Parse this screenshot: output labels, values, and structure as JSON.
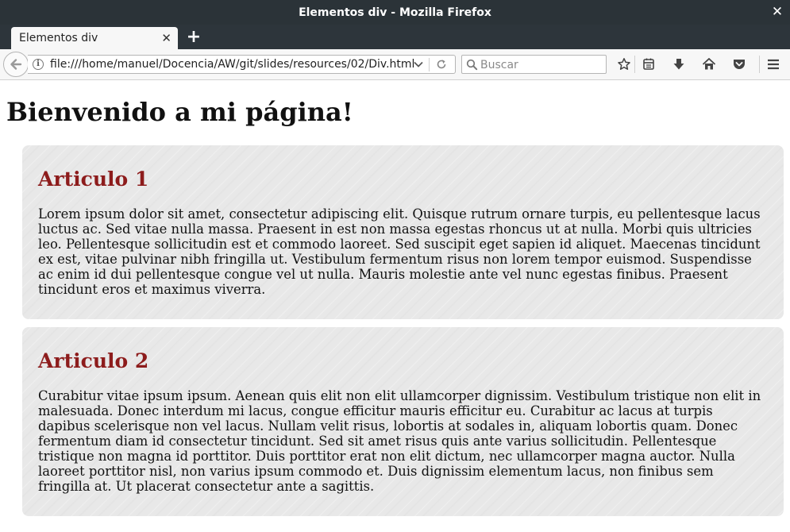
{
  "window": {
    "title": "Elementos div - Mozilla Firefox",
    "close_glyph": "✕"
  },
  "tabs": [
    {
      "label": "Elementos div",
      "close_glyph": "✕"
    }
  ],
  "new_tab_glyph": "+",
  "navbar": {
    "info_glyph": "i",
    "url": "file:///home/manuel/Docencia/AW/git/slides/resources/02/Div.html",
    "search_placeholder": "Buscar",
    "icons": [
      "back-arrow-icon",
      "info-icon",
      "dropdown-arrow-icon",
      "reload-icon",
      "search-icon",
      "bookmark-star-icon",
      "reading-list-icon",
      "download-icon",
      "home-icon",
      "pocket-icon",
      "menu-icon"
    ]
  },
  "page": {
    "title": "Bienvenido a mi página!",
    "articles": [
      {
        "title": "Articulo 1",
        "body": "Lorem ipsum dolor sit amet, consectetur adipiscing elit. Quisque rutrum ornare turpis, eu pellentesque lacus luctus ac. Sed vitae nulla massa. Praesent in est non massa egestas rhoncus ut at nulla. Morbi quis ultricies leo. Pellentesque sollicitudin est et commodo laoreet. Sed suscipit eget sapien id aliquet. Maecenas tincidunt ex est, vitae pulvinar nibh fringilla ut. Vestibulum fermentum risus non lorem tempor euismod. Suspendisse ac enim id dui pellentesque congue vel ut nulla. Mauris molestie ante vel nunc egestas finibus. Praesent tincidunt eros et maximus viverra."
      },
      {
        "title": "Articulo 2",
        "body": "Curabitur vitae ipsum ipsum. Aenean quis elit non elit ullamcorper dignissim. Vestibulum tristique non elit in malesuada. Donec interdum mi lacus, congue efficitur mauris efficitur eu. Curabitur ac lacus at turpis dapibus scelerisque non vel lacus. Nullam velit risus, lobortis at sodales in, aliquam lobortis quam. Donec fermentum diam id consectetur tincidunt. Sed sit amet risus quis ante varius sollicitudin. Pellentesque tristique non magna id porttitor. Duis porttitor erat non elit dictum, nec ullamcorper magna auctor. Nulla laoreet porttitor nisl, non varius ipsum commodo et. Duis dignissim elementum lacus, non finibus sem fringilla at. Ut placerat consectetur ante a sagittis."
      }
    ]
  },
  "colors": {
    "title_bar": "#2b3338",
    "tab_bar": "#2d353b",
    "toolbar": "#f7f7f7",
    "article_bg": "#e8e8e8",
    "article_title": "#8d1c1c"
  }
}
